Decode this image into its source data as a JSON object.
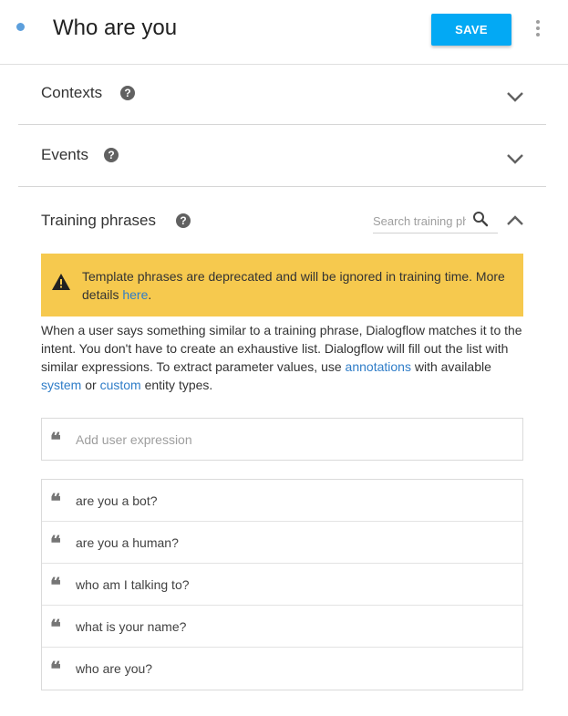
{
  "header": {
    "title": "Who are you",
    "save_label": "SAVE",
    "status_dot_color": "#5c9fdc",
    "save_color": "#03a9f4"
  },
  "sections": [
    {
      "label": "Contexts",
      "icon": "help-icon",
      "state": "collapsed"
    },
    {
      "label": "Events",
      "icon": "help-icon",
      "state": "collapsed"
    }
  ],
  "training": {
    "label": "Training phrases",
    "search_placeholder": "Search training phrases",
    "state": "expanded",
    "warning": {
      "text_before": "Template phrases are deprecated and will be ignored in training time. More details ",
      "link": "here",
      "text_after": ".",
      "color": "#f6c94e"
    },
    "description": {
      "part1": "When a user says something similar to a training phrase, Dialogflow matches it to the intent. You don't have to create an exhaustive list. Dialogflow will fill out the list with similar expressions. To extract parameter values, use ",
      "link1": "annotations",
      "part2": " with available ",
      "link2": "system",
      "part3": " or ",
      "link3": "custom",
      "part4": " entity types."
    },
    "add_placeholder": "Add user expression",
    "phrases": [
      "are you a bot?",
      "are you a human?",
      "who am I talking to?",
      "what is your name?",
      "who are you?"
    ]
  }
}
